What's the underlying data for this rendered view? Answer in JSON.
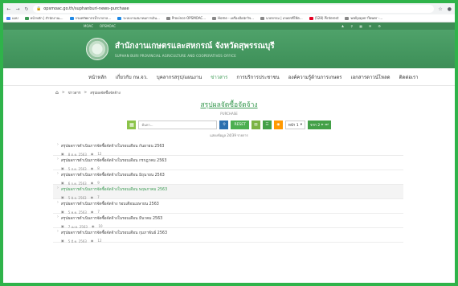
{
  "browser": {
    "url": "opsmoac.go.th/suphanburi-news-purchase",
    "bookmarks": [
      {
        "label": "แอป",
        "color": "#4285f4"
      },
      {
        "label": "หน้าหลัก | สำนักงานเ...",
        "color": "#3a9a52"
      },
      {
        "label": "กรมทรัพยากรน้ำบาดาล...",
        "color": "#1e88e5"
      },
      {
        "label": "ระบบงานสมาคมการเงิน...",
        "color": "#1e88e5"
      },
      {
        "label": "Province OPSMOAC...",
        "color": "#888888"
      },
      {
        "label": "Home - เครื่องมือนักวิจ...",
        "color": "#888888"
      },
      {
        "label": "นวตกรรม | เกษตรที่ใช้ต...",
        "color": "#888888"
      },
      {
        "label": "(528) Pinterest",
        "color": "#e60023"
      },
      {
        "label": "wallpaper flower -...",
        "color": "#888888"
      }
    ]
  },
  "site": {
    "top_left": [
      "MOAC",
      "OPSMOAC"
    ],
    "title_th": "สำนักงานเกษตรและสหกรณ์ จังหวัดสุพรรณบุรี",
    "title_en": "SUPHAN BURI PROVINCIAL AGRICULTURE AND COOPERATIVES OFFICE"
  },
  "menu": [
    "หน้าหลัก",
    "เกี่ยวกับ กษ.จว.",
    "บุคลากรสรุป/แผนงาน",
    "ข่าวสาร",
    "การบริการประชาชน",
    "องค์ความรู้ด้านการเกษตร",
    "เอกสารดาวน์โหลด",
    "ติดต่อเรา"
  ],
  "menu_active_index": 3,
  "breadcrumb": [
    "ข่าวสาร",
    "สรุปผลจัดซื้อจัดจ้าง"
  ],
  "page": {
    "title": "สรุปผลจัดซื้อจัดจ้าง",
    "subtitle": "PURCHASE",
    "search_placeholder": "ค้นหา...",
    "reset_label": "RESET",
    "page_label": "หน้า 1",
    "page_of": "จาก 2",
    "results": "แสดงข้อมูล 24/39 รายการ"
  },
  "items": [
    {
      "title": "สรุปผลการดำเนินการจัดซื้อจัดจ้างในรอบเดือน กันยายน 2563",
      "date": "8 ต.ค. 2563",
      "views": "12",
      "highlight": false
    },
    {
      "title": "สรุปผลการดำเนินการจัดซื้อจัดจ้างในรอบเดือน กรกฎาคม 2563",
      "date": "5 ส.ค. 2563",
      "views": "8",
      "highlight": false
    },
    {
      "title": "สรุปผลการดำเนินการจัดซื้อจัดจ้างในรอบเดือน มิถุนายน 2563",
      "date": "6 ก.ค. 2563",
      "views": "9",
      "highlight": false
    },
    {
      "title": "สรุปผลการดำเนินการจัดซื้อจัดจ้างในรอบเดือน พฤษภาคม 2563",
      "date": "5 มิ.ย. 2563",
      "views": "7",
      "highlight": true
    },
    {
      "title": "สรุปผลการดำเนินการจัดซื้อจัดจ้าง รอบเดือนเมษายน 2563",
      "date": "5 พ.ค. 2563",
      "views": "7",
      "highlight": false
    },
    {
      "title": "สรุปผลการดำเนินการจัดซื้อจัดจ้างในรอบเดือน มีนาคม 2563",
      "date": "7 เม.ย. 2563",
      "views": "10",
      "highlight": false
    },
    {
      "title": "สรุปผลการดำเนินการจัดซื้อจัดจ้างในรอบเดือน กุมภาพันธ์ 2563",
      "date": "5 มี.ค. 2563",
      "views": "12",
      "highlight": false
    }
  ]
}
